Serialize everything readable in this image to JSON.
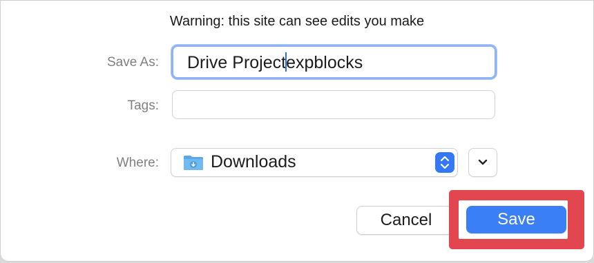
{
  "dialog": {
    "warning": "Warning: this site can see edits you make",
    "save_as": {
      "label": "Save As:",
      "value_before_caret": "Drive Project",
      "value_after_caret": "expblocks"
    },
    "tags": {
      "label": "Tags:",
      "value": ""
    },
    "where": {
      "label": "Where:",
      "value": "Downloads",
      "icon": "downloads-folder-icon"
    },
    "buttons": {
      "cancel": "Cancel",
      "save": "Save"
    }
  },
  "colors": {
    "accent": "#3a7ff6",
    "focus_ring": "#8fb4f4",
    "highlight": "#e2474f",
    "label": "#808080"
  }
}
